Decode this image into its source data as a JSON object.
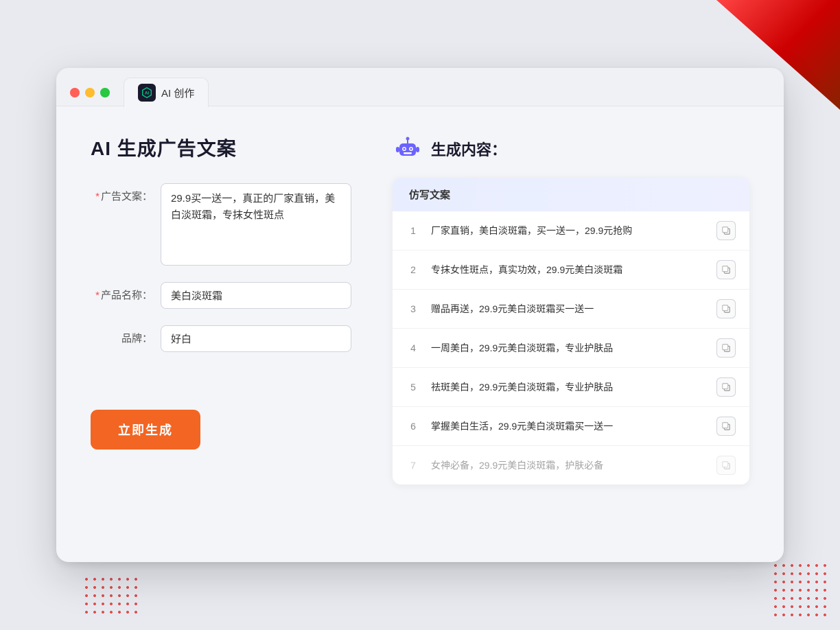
{
  "window": {
    "tab_label": "AI 创作"
  },
  "left": {
    "title": "AI 生成广告文案",
    "form": {
      "ad_copy_label": "广告文案：",
      "ad_copy_required": "*",
      "ad_copy_value": "29.9买一送一，真正的厂家直销，美白淡斑霜，专抹女性斑点",
      "product_name_label": "产品名称：",
      "product_name_required": "*",
      "product_name_value": "美白淡斑霜",
      "brand_label": "品牌：",
      "brand_value": "好白"
    },
    "generate_btn": "立即生成"
  },
  "right": {
    "title": "生成内容：",
    "table_header": "仿写文案",
    "rows": [
      {
        "num": "1",
        "text": "厂家直销，美白淡斑霜，买一送一，29.9元抢购",
        "faded": false
      },
      {
        "num": "2",
        "text": "专抹女性斑点，真实功效，29.9元美白淡斑霜",
        "faded": false
      },
      {
        "num": "3",
        "text": "赠品再送，29.9元美白淡斑霜买一送一",
        "faded": false
      },
      {
        "num": "4",
        "text": "一周美白，29.9元美白淡斑霜，专业护肤品",
        "faded": false
      },
      {
        "num": "5",
        "text": "祛斑美白，29.9元美白淡斑霜，专业护肤品",
        "faded": false
      },
      {
        "num": "6",
        "text": "掌握美白生活，29.9元美白淡斑霜买一送一",
        "faded": false
      },
      {
        "num": "7",
        "text": "女神必备，29.9元美白淡斑霜，护肤必备",
        "faded": true
      }
    ]
  }
}
